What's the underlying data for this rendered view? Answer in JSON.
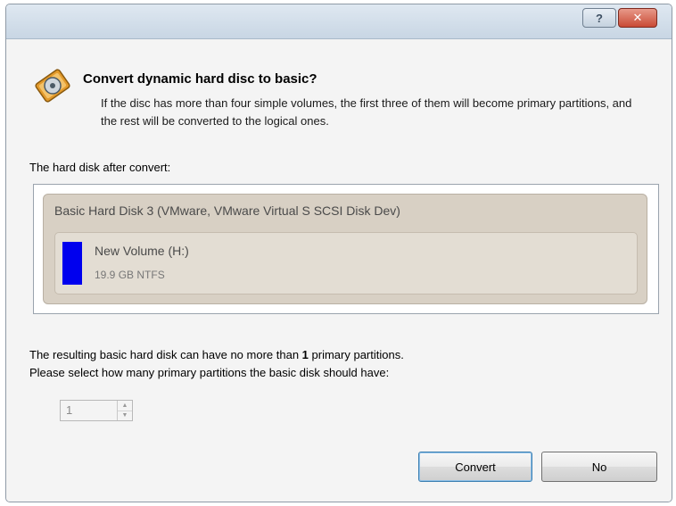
{
  "titlebar": {
    "help_label": "?",
    "close_label": "✕"
  },
  "header": {
    "title": "Convert dynamic hard disc to basic?",
    "description": "If the disc has more than four simple volumes, the first three of them will become primary partitions, and the rest will be converted to the logical ones."
  },
  "preview": {
    "label": "The hard disk after convert:",
    "disk_name": "Basic Hard Disk 3 (VMware, VMware Virtual S SCSI Disk Dev)",
    "volume": {
      "name": "New Volume (H:)",
      "info": "19.9 GB NTFS",
      "color": "#0000ee"
    }
  },
  "notes": {
    "line1_prefix": "The resulting basic hard disk can have no more than ",
    "line1_count": "1",
    "line1_suffix": " primary partitions.",
    "line2": "Please select how many primary partitions the basic disk should have:"
  },
  "spinner": {
    "value": "1"
  },
  "buttons": {
    "convert": "Convert",
    "no": "No"
  },
  "icons": {
    "header": "disk-convert-icon"
  }
}
